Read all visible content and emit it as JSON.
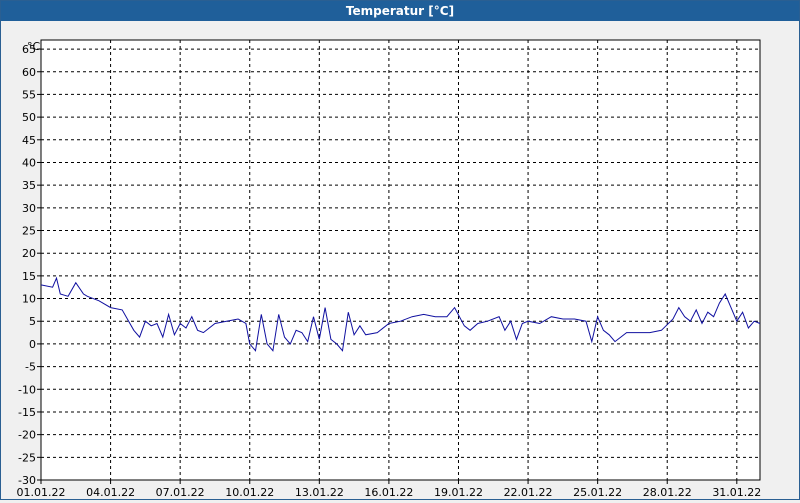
{
  "window": {
    "title": "Temperatur [°C]"
  },
  "colors": {
    "series": "#1010a0",
    "grid": "#000000",
    "plot_bg": "#ffffff",
    "title_bg": "#1f5f9a"
  },
  "chart_data": {
    "type": "line",
    "title": "Temperatur [°C]",
    "ylabel": "°C",
    "xlabel": "",
    "ylim": [
      -30,
      67
    ],
    "yticks": [
      65,
      60,
      55,
      50,
      45,
      40,
      35,
      30,
      25,
      20,
      15,
      10,
      5,
      0,
      -5,
      -10,
      -15,
      -20,
      -25,
      -30
    ],
    "xlim": [
      "2022-01-01",
      "2022-02-01"
    ],
    "xtick_labels": [
      "01.01.22",
      "04.01.22",
      "07.01.22",
      "10.01.22",
      "13.01.22",
      "16.01.22",
      "19.01.22",
      "22.01.22",
      "25.01.22",
      "28.01.22",
      "31.01.22"
    ],
    "grid": true,
    "series": [
      {
        "x": [
          "2022-01-01 00:00",
          "2022-01-01 12:00",
          "2022-01-01 16:00",
          "2022-01-01 20:00",
          "2022-01-02 04:00",
          "2022-01-02 12:00",
          "2022-01-02 20:00",
          "2022-01-03 00:00",
          "2022-01-03 12:00",
          "2022-01-04 00:00",
          "2022-01-04 12:00",
          "2022-01-05 00:00",
          "2022-01-05 06:00",
          "2022-01-05 12:00",
          "2022-01-05 18:00",
          "2022-01-06 00:00",
          "2022-01-06 06:00",
          "2022-01-06 12:00",
          "2022-01-06 18:00",
          "2022-01-07 00:00",
          "2022-01-07 06:00",
          "2022-01-07 12:00",
          "2022-01-07 18:00",
          "2022-01-08 00:00",
          "2022-01-08 12:00",
          "2022-01-09 00:00",
          "2022-01-09 12:00",
          "2022-01-09 20:00",
          "2022-01-10 00:00",
          "2022-01-10 06:00",
          "2022-01-10 12:00",
          "2022-01-10 18:00",
          "2022-01-11 00:00",
          "2022-01-11 06:00",
          "2022-01-11 12:00",
          "2022-01-11 18:00",
          "2022-01-12 00:00",
          "2022-01-12 06:00",
          "2022-01-12 12:00",
          "2022-01-12 18:00",
          "2022-01-13 00:00",
          "2022-01-13 06:00",
          "2022-01-13 12:00",
          "2022-01-13 18:00",
          "2022-01-14 00:00",
          "2022-01-14 06:00",
          "2022-01-14 12:00",
          "2022-01-14 18:00",
          "2022-01-15 00:00",
          "2022-01-15 12:00",
          "2022-01-16 00:00",
          "2022-01-16 12:00",
          "2022-01-17 00:00",
          "2022-01-17 12:00",
          "2022-01-18 00:00",
          "2022-01-18 12:00",
          "2022-01-18 20:00",
          "2022-01-19 06:00",
          "2022-01-19 12:00",
          "2022-01-19 20:00",
          "2022-01-20 06:00",
          "2022-01-20 18:00",
          "2022-01-21 00:00",
          "2022-01-21 06:00",
          "2022-01-21 12:00",
          "2022-01-21 18:00",
          "2022-01-22 00:00",
          "2022-01-22 12:00",
          "2022-01-23 00:00",
          "2022-01-23 12:00",
          "2022-01-24 00:00",
          "2022-01-24 12:00",
          "2022-01-24 18:00",
          "2022-01-25 00:00",
          "2022-01-25 06:00",
          "2022-01-25 12:00",
          "2022-01-25 18:00",
          "2022-01-26 06:00",
          "2022-01-26 18:00",
          "2022-01-27 06:00",
          "2022-01-27 18:00",
          "2022-01-28 06:00",
          "2022-01-28 12:00",
          "2022-01-28 18:00",
          "2022-01-29 00:00",
          "2022-01-29 06:00",
          "2022-01-29 12:00",
          "2022-01-29 18:00",
          "2022-01-30 00:00",
          "2022-01-30 06:00",
          "2022-01-30 12:00",
          "2022-01-30 18:00",
          "2022-01-31 00:00",
          "2022-01-31 06:00",
          "2022-01-31 12:00",
          "2022-01-31 18:00",
          "2022-02-01 00:00"
        ],
        "values": [
          13,
          12.5,
          14.5,
          11,
          10.5,
          13.5,
          11,
          10.5,
          9.5,
          8,
          7.5,
          3,
          1.5,
          5,
          4,
          4.5,
          1.5,
          6.5,
          2,
          4.5,
          3.5,
          6,
          3,
          2.5,
          4.5,
          5,
          5.5,
          4.5,
          0,
          -1.5,
          6.5,
          0,
          -1.5,
          6.5,
          1.5,
          0,
          3,
          2.5,
          0.5,
          6,
          1,
          8,
          1,
          0,
          -1.5,
          7,
          2,
          4,
          2,
          2.5,
          4.5,
          5,
          6,
          6.5,
          6,
          6,
          8,
          4,
          3,
          4.5,
          5,
          6,
          3,
          5,
          1,
          4.5,
          5,
          4.5,
          6,
          5.5,
          5.5,
          5,
          0.5,
          6,
          3,
          2,
          0.5,
          2.5,
          2.5,
          2.5,
          3,
          5.5,
          8,
          6,
          5,
          7.5,
          4.5,
          7,
          6,
          9,
          11,
          8,
          5,
          7,
          3.5,
          5,
          4.5
        ]
      }
    ]
  }
}
